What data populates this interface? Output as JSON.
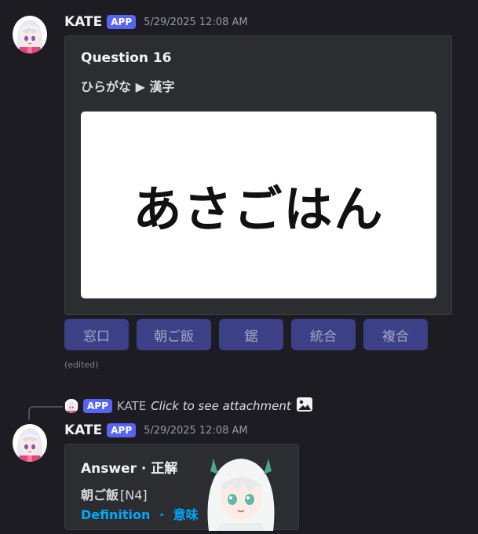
{
  "colors": {
    "background": "#1c1c22",
    "embed": "#2b2d31",
    "accent": "#5865f2",
    "button": "#3b4087",
    "link": "#00a8fc"
  },
  "messages": [
    {
      "username": "KATE",
      "badge": "APP",
      "timestamp": "5/29/2025 12:08 AM",
      "embed": {
        "title": "Question 16",
        "subtitle": "ひらがな ▶ 漢字",
        "image_word": "あさごはん"
      },
      "buttons": [
        "窓口",
        "朝ご飯",
        "鋸",
        "統合",
        "複合"
      ],
      "edited": "(edited)"
    },
    {
      "reply": {
        "badge": "APP",
        "username": "KATE",
        "text": "Click to see attachment",
        "icon": "image-icon"
      },
      "username": "KATE",
      "badge": "APP",
      "timestamp": "5/29/2025 12:08 AM",
      "embed": {
        "title": "Answer · 正解",
        "word": "朝ご飯",
        "level": "[N4]",
        "definition_link": "Definition",
        "separator": "·",
        "meaning_link": "意味"
      }
    }
  ]
}
